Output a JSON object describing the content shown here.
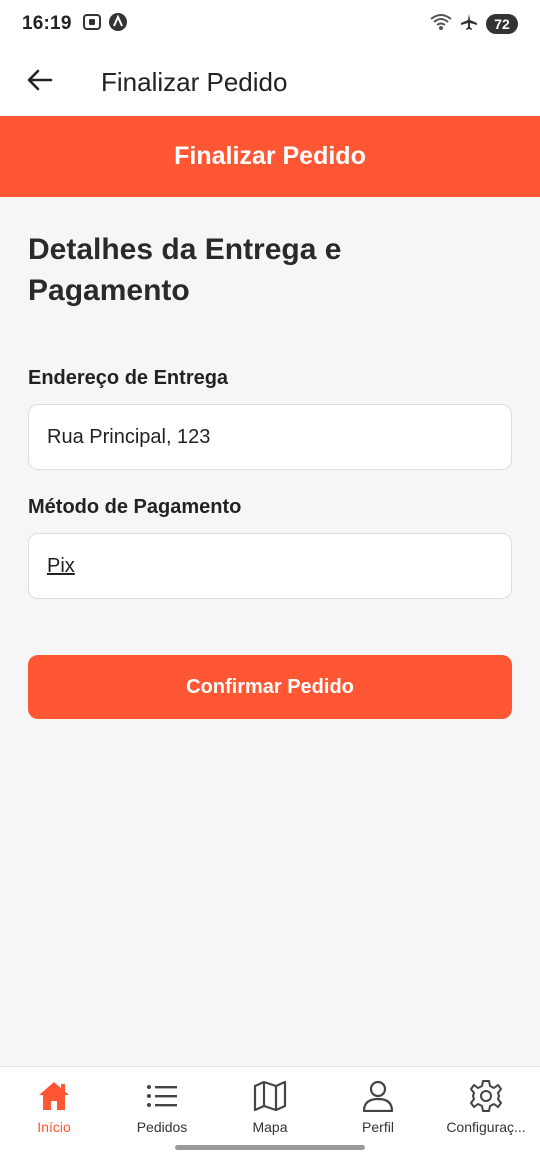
{
  "status_bar": {
    "time": "16:19",
    "battery": "72",
    "left_icons": [
      "screenshot-icon",
      "app-notification-icon"
    ],
    "right_icons": [
      "wifi-icon",
      "airplane-mode-icon",
      "battery-icon"
    ]
  },
  "app_bar": {
    "back_icon": "arrow-left-icon",
    "title": "Finalizar Pedido"
  },
  "banner": {
    "title": "Finalizar Pedido",
    "color": "#ff5733"
  },
  "form": {
    "section_title": "Detalhes da Entrega e Pagamento",
    "address_label": "Endereço de Entrega",
    "address_value": "Rua Principal, 123",
    "payment_label": "Método de Pagamento",
    "payment_value": "Pix",
    "confirm_label": "Confirmar Pedido"
  },
  "bottom_nav": {
    "active_color": "#ff5733",
    "items": [
      {
        "label": "Início",
        "icon": "home-icon",
        "active": true
      },
      {
        "label": "Pedidos",
        "icon": "list-icon",
        "active": false
      },
      {
        "label": "Mapa",
        "icon": "map-icon",
        "active": false
      },
      {
        "label": "Perfil",
        "icon": "person-icon",
        "active": false
      },
      {
        "label": "Configuraç...",
        "icon": "gear-icon",
        "active": false
      }
    ]
  }
}
